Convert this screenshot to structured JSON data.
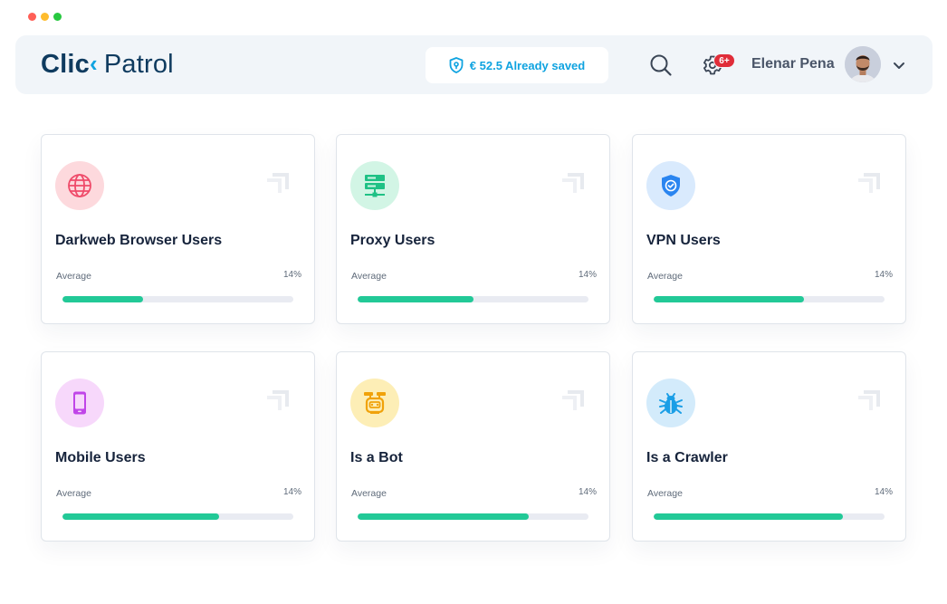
{
  "window": {
    "dots": [
      "#ff5f57",
      "#febc2e",
      "#28c840"
    ]
  },
  "header": {
    "logo": {
      "part1": "Clic",
      "chevron": "‹",
      "part2": "Patrol"
    },
    "saved": {
      "icon": "shield-icon",
      "text": "€ 52.5 Already saved"
    },
    "search_icon": "search-icon",
    "settings_icon": "gear-icon",
    "notifications_badge": "6+",
    "user_name": "Elenar Pena",
    "user_menu_icon": "chevron-down-icon"
  },
  "cards": [
    {
      "title": "Darkweb Browser Users",
      "average_label": "Average",
      "percent": "14%",
      "progress": 0.35,
      "icon": "globe-icon",
      "icon_bg": "#fdd9dd",
      "icon_color": "#ef4b6a"
    },
    {
      "title": "Proxy Users",
      "average_label": "Average",
      "percent": "14%",
      "progress": 0.5,
      "icon": "server-icon",
      "icon_bg": "#d2f5e5",
      "icon_color": "#1fc185"
    },
    {
      "title": "VPN Users",
      "average_label": "Average",
      "percent": "14%",
      "progress": 0.65,
      "icon": "shield-check-icon",
      "icon_bg": "#d9eafd",
      "icon_color": "#2a85f0"
    },
    {
      "title": "Mobile Users",
      "average_label": "Average",
      "percent": "14%",
      "progress": 0.68,
      "icon": "smartphone-icon",
      "icon_bg": "#f7d8fb",
      "icon_color": "#c045e8"
    },
    {
      "title": "Is a Bot",
      "average_label": "Average",
      "percent": "14%",
      "progress": 0.74,
      "icon": "robot-icon",
      "icon_bg": "#fdeeb6",
      "icon_color": "#f0a20a"
    },
    {
      "title": "Is a Crawler",
      "average_label": "Average",
      "percent": "14%",
      "progress": 0.82,
      "icon": "bug-icon",
      "icon_bg": "#d3ebfb",
      "icon_color": "#1a9ee6"
    }
  ],
  "colors": {
    "accent": "#0fa3e0",
    "progress": "#22c997",
    "track": "#e9ebf2",
    "brand_dark": "#0f3b5f"
  }
}
